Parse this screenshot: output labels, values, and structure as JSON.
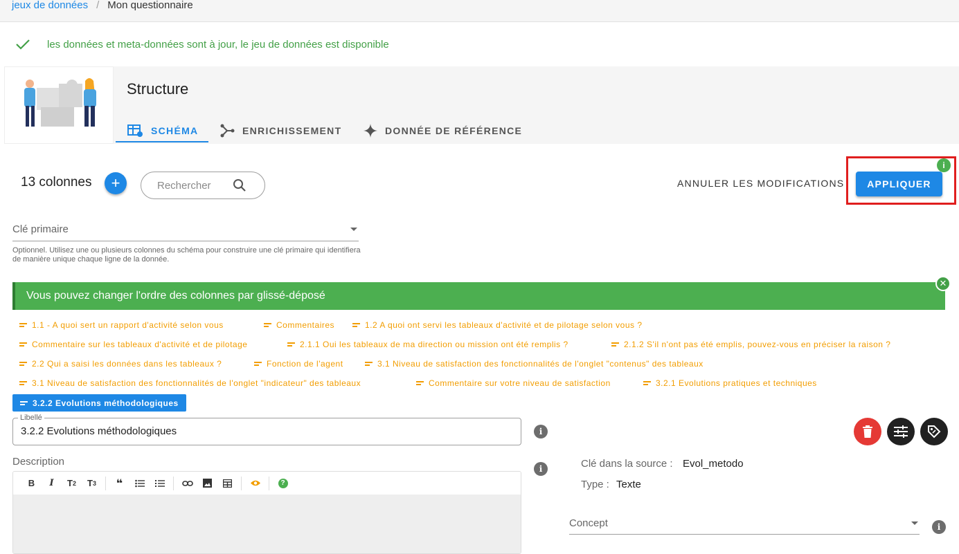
{
  "breadcrumb": {
    "parent": "jeux de données",
    "separator": "/",
    "current": "Mon questionnaire"
  },
  "status": {
    "message": "les données et meta-données sont à jour, le jeu de données est disponible",
    "color": "#43a047"
  },
  "header": {
    "title": "Structure",
    "tabs": [
      {
        "label": "SCHÉMA",
        "icon": "table-settings-icon",
        "active": true
      },
      {
        "label": "ENRICHISSEMENT",
        "icon": "merge-icon",
        "active": false
      },
      {
        "label": "DONNÉE DE RÉFÉRENCE",
        "icon": "sparkle-icon",
        "active": false
      }
    ]
  },
  "toolbar": {
    "column_count": "13 colonnes",
    "add_label": "+",
    "search_placeholder": "Rechercher",
    "cancel_label": "ANNULER LES MODIFICATIONS",
    "apply_label": "APPLIQUER",
    "apply_info": "i"
  },
  "primary_key": {
    "label": "Clé primaire",
    "hint": "Optionnel. Utilisez une ou plusieurs colonnes du schéma pour construire une clé primaire qui identifiera de manière unique chaque ligne de la donnée."
  },
  "reorder_alert": {
    "message": "Vous pouvez changer l'ordre des colonnes par glissé-déposé",
    "close": "✕"
  },
  "columns": [
    "1.1 - A quoi sert un rapport d'activité selon vous",
    "Commentaires",
    "1.2 A quoi ont servi les tableaux d'activité et de pilotage selon vous ?",
    "Commentaire sur les tableaux d'activité et de pilotage",
    "2.1.1 Oui les tableaux de ma direction ou mission ont été remplis ?",
    "2.1.2 S'il n'ont pas été emplis, pouvez-vous en préciser la raison ?",
    "2.2 Qui a saisi les données dans les tableaux ?",
    "Fonction de l'agent",
    "3.1 Niveau de satisfaction des fonctionnalités de l'onglet \"contenus\" des tableaux",
    "3.1 Niveau de satisfaction des fonctionnalités de l'onglet \"indicateur\" des tableaux",
    "Commentaire sur votre niveau de satisfaction",
    "3.2.1 Evolutions pratiques et techniques",
    "3.2.2 Evolutions méthodologiques"
  ],
  "active_column": {
    "libelle_label": "Libellé",
    "libelle_value": "3.2.2 Evolutions méthodologiques",
    "description_label": "Description",
    "key_label": "Clé dans la source :",
    "key_value": "Evol_metodo",
    "type_label": "Type :",
    "type_value": "Texte",
    "concept_label": "Concept"
  },
  "editor_toolbar": [
    "B",
    "I",
    "T2",
    "T3",
    "quote",
    "bullet-list",
    "numbered-list",
    "link",
    "image",
    "table",
    "preview",
    "help"
  ],
  "colors": {
    "primary": "#1e88e5",
    "success": "#4caf50",
    "warning": "#f29d00",
    "danger": "#e53935",
    "highlight": "#e01e1e"
  }
}
